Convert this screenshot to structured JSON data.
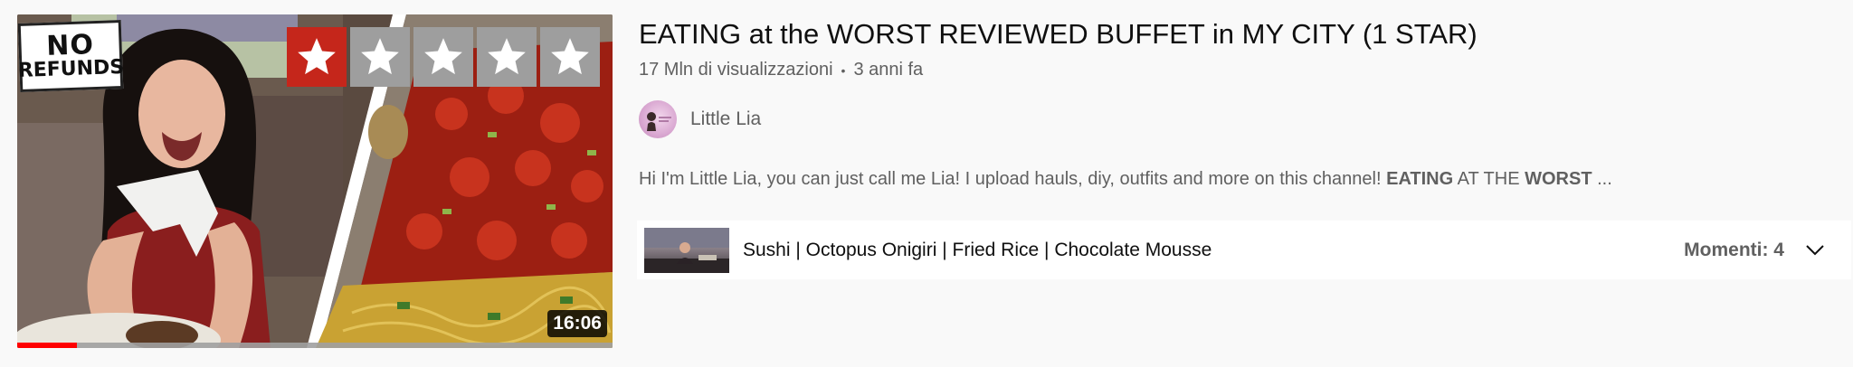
{
  "video": {
    "title": "EATING at the WORST REVIEWED BUFFET in MY CITY (1 STAR)",
    "views": "17 Mln di visualizzazioni",
    "separator": "•",
    "age": "3 anni fa",
    "duration": "16:06",
    "watch_progress": 0.1,
    "thumbnail": {
      "sign_line1": "NO",
      "sign_line2": "REFUNDS",
      "rating_stars_filled": 1,
      "rating_stars_total": 5
    }
  },
  "channel": {
    "name": "Little Lia",
    "avatar_icon": "channel-avatar"
  },
  "description": {
    "part1": "Hi I'm Little Lia, you can just call me Lia! I upload hauls, diy, outfits and more on this channel! ",
    "bold1": "EATING",
    "part2": " AT THE ",
    "bold2": "WORST",
    "part3": " ..."
  },
  "chapters": {
    "current": "Sushi | Octopus Onigiri | Fried Rice | Chocolate Mousse",
    "count_label": "Momenti: 4",
    "expand_icon": "chevron-down-icon"
  },
  "colors": {
    "background": "#f9f9f9",
    "progress": "#ff0000",
    "star_filled_bg": "#c5261b",
    "star_empty_bg": "#9e9e9e",
    "secondary_text": "#606060"
  }
}
